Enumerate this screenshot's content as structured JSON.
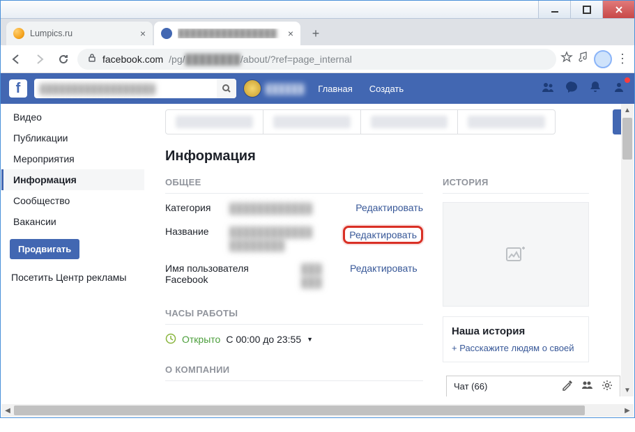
{
  "window": {
    "tabs": [
      {
        "title": "Lumpics.ru",
        "active": false
      },
      {
        "title": "████████████████",
        "active": true
      }
    ]
  },
  "addressbar": {
    "domain": "facebook.com",
    "path_prefix": "/pg/",
    "path_blur": "████████",
    "path_suffix": "/about/?ref=page_internal"
  },
  "fb_header": {
    "nav_home": "Главная",
    "nav_create": "Создать"
  },
  "sidebar": {
    "items": [
      {
        "label": "Видео",
        "active": false
      },
      {
        "label": "Публикации",
        "active": false
      },
      {
        "label": "Мероприятия",
        "active": false
      },
      {
        "label": "Информация",
        "active": true
      },
      {
        "label": "Сообщество",
        "active": false
      },
      {
        "label": "Вакансии",
        "active": false
      }
    ],
    "promote": "Продвигать",
    "ad_center": "Посетить Центр рекламы"
  },
  "main": {
    "heading": "Информация",
    "section_general": "ОБЩЕЕ",
    "row_category": {
      "label": "Категория",
      "edit": "Редактировать"
    },
    "row_name": {
      "label": "Название",
      "edit": "Редактировать"
    },
    "row_username": {
      "label": "Имя пользователя Facebook",
      "edit": "Редактировать"
    },
    "section_hours": "ЧАСЫ РАБОТЫ",
    "hours_open": "Открыто",
    "hours_range": "С 00:00 до 23:55",
    "section_about": "О КОМПАНИИ",
    "section_story": "ИСТОРИЯ",
    "story_title": "Наша история",
    "story_tell": "+ Расскажите людям о своей"
  },
  "chat": {
    "label": "Чат (66)"
  }
}
